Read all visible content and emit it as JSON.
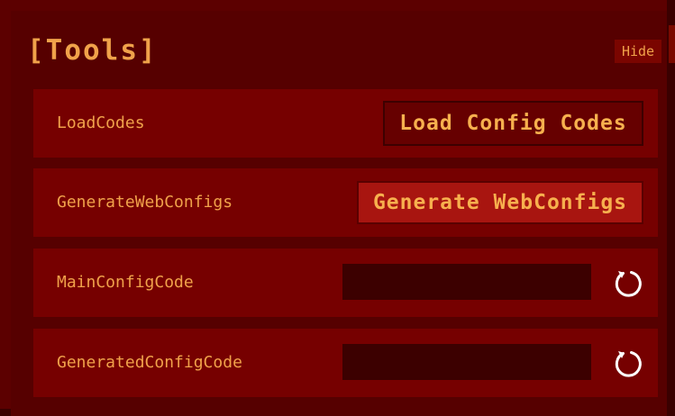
{
  "panel": {
    "title": "[Tools]",
    "hide_label": "Hide"
  },
  "rows": [
    {
      "label": "LoadCodes",
      "button_label": "Load Config Codes"
    },
    {
      "label": "GenerateWebConfigs",
      "button_label": "Generate WebConfigs"
    },
    {
      "label": "MainConfigCode",
      "value": "",
      "reset_icon": "reset-icon"
    },
    {
      "label": "GeneratedConfigCode",
      "value": "",
      "reset_icon": "reset-icon"
    }
  ],
  "colors": {
    "background": "#560000",
    "row": "#760000",
    "accent_text": "#f0a24a",
    "primary_button": "#a81510",
    "field": "#3c0000"
  }
}
